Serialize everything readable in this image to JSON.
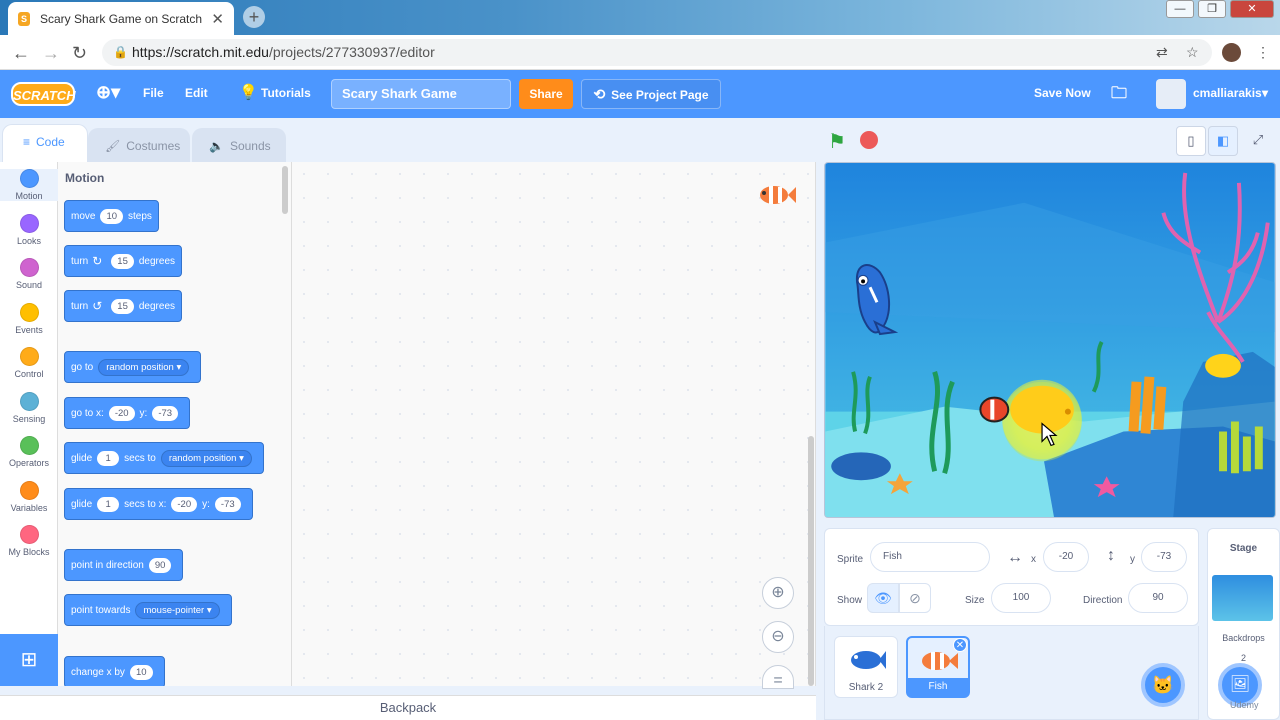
{
  "browser": {
    "tab_title": "Scary Shark Game on Scratch",
    "tab_close": "✕",
    "new_tab": "+",
    "url_host": "https://scratch.mit.edu",
    "url_path": "/projects/277330937/editor",
    "win_min": "—",
    "win_max": "❐",
    "win_close": "✕"
  },
  "menubar": {
    "logo": "SCRATCH",
    "file": "File",
    "edit": "Edit",
    "tutorials": "Tutorials",
    "project_title": "Scary Shark Game",
    "share": "Share",
    "see_project_page": "See Project Page",
    "save_now": "Save Now",
    "username": "cmalliarakis"
  },
  "editor_tabs": {
    "code": "Code",
    "costumes": "Costumes",
    "sounds": "Sounds"
  },
  "categories": [
    {
      "label": "Motion",
      "color": "#4c97ff"
    },
    {
      "label": "Looks",
      "color": "#9966ff"
    },
    {
      "label": "Sound",
      "color": "#cf63cf"
    },
    {
      "label": "Events",
      "color": "#ffbf00"
    },
    {
      "label": "Control",
      "color": "#ffab19"
    },
    {
      "label": "Sensing",
      "color": "#5cb1d6"
    },
    {
      "label": "Operators",
      "color": "#59c059"
    },
    {
      "label": "Variables",
      "color": "#ff8c1a"
    },
    {
      "label": "My Blocks",
      "color": "#ff6680"
    }
  ],
  "palette": {
    "header": "Motion",
    "move": {
      "a": "move",
      "v": "10",
      "b": "steps"
    },
    "turn_right": {
      "a": "turn",
      "v": "15",
      "b": "degrees"
    },
    "turn_left": {
      "a": "turn",
      "v": "15",
      "b": "degrees"
    },
    "goto": {
      "a": "go to",
      "dd": "random position"
    },
    "goto_xy": {
      "a": "go to x:",
      "x": "-20",
      "b": "y:",
      "y": "-73"
    },
    "glide_to": {
      "a": "glide",
      "v": "1",
      "b": "secs to",
      "dd": "random position"
    },
    "glide_xy": {
      "a": "glide",
      "v": "1",
      "b": "secs to x:",
      "x": "-20",
      "c": "y:",
      "y": "-73"
    },
    "point_dir": {
      "a": "point in direction",
      "v": "90"
    },
    "point_towards": {
      "a": "point towards",
      "dd": "mouse-pointer"
    },
    "change_x": {
      "a": "change x by",
      "v": "10"
    }
  },
  "backpack": "Backpack",
  "sprite_info": {
    "sprite_label": "Sprite",
    "sprite_name": "Fish",
    "x_label": "x",
    "x_value": "-20",
    "y_label": "y",
    "y_value": "-73",
    "show_label": "Show",
    "size_label": "Size",
    "size_value": "100",
    "direction_label": "Direction",
    "direction_value": "90"
  },
  "sprites": [
    {
      "name": "Shark 2",
      "selected": false
    },
    {
      "name": "Fish",
      "selected": true
    }
  ],
  "stage_panel": {
    "title": "Stage",
    "backdrops_label": "Backdrops",
    "backdrops_count": "2"
  },
  "watermark": "Udemy"
}
